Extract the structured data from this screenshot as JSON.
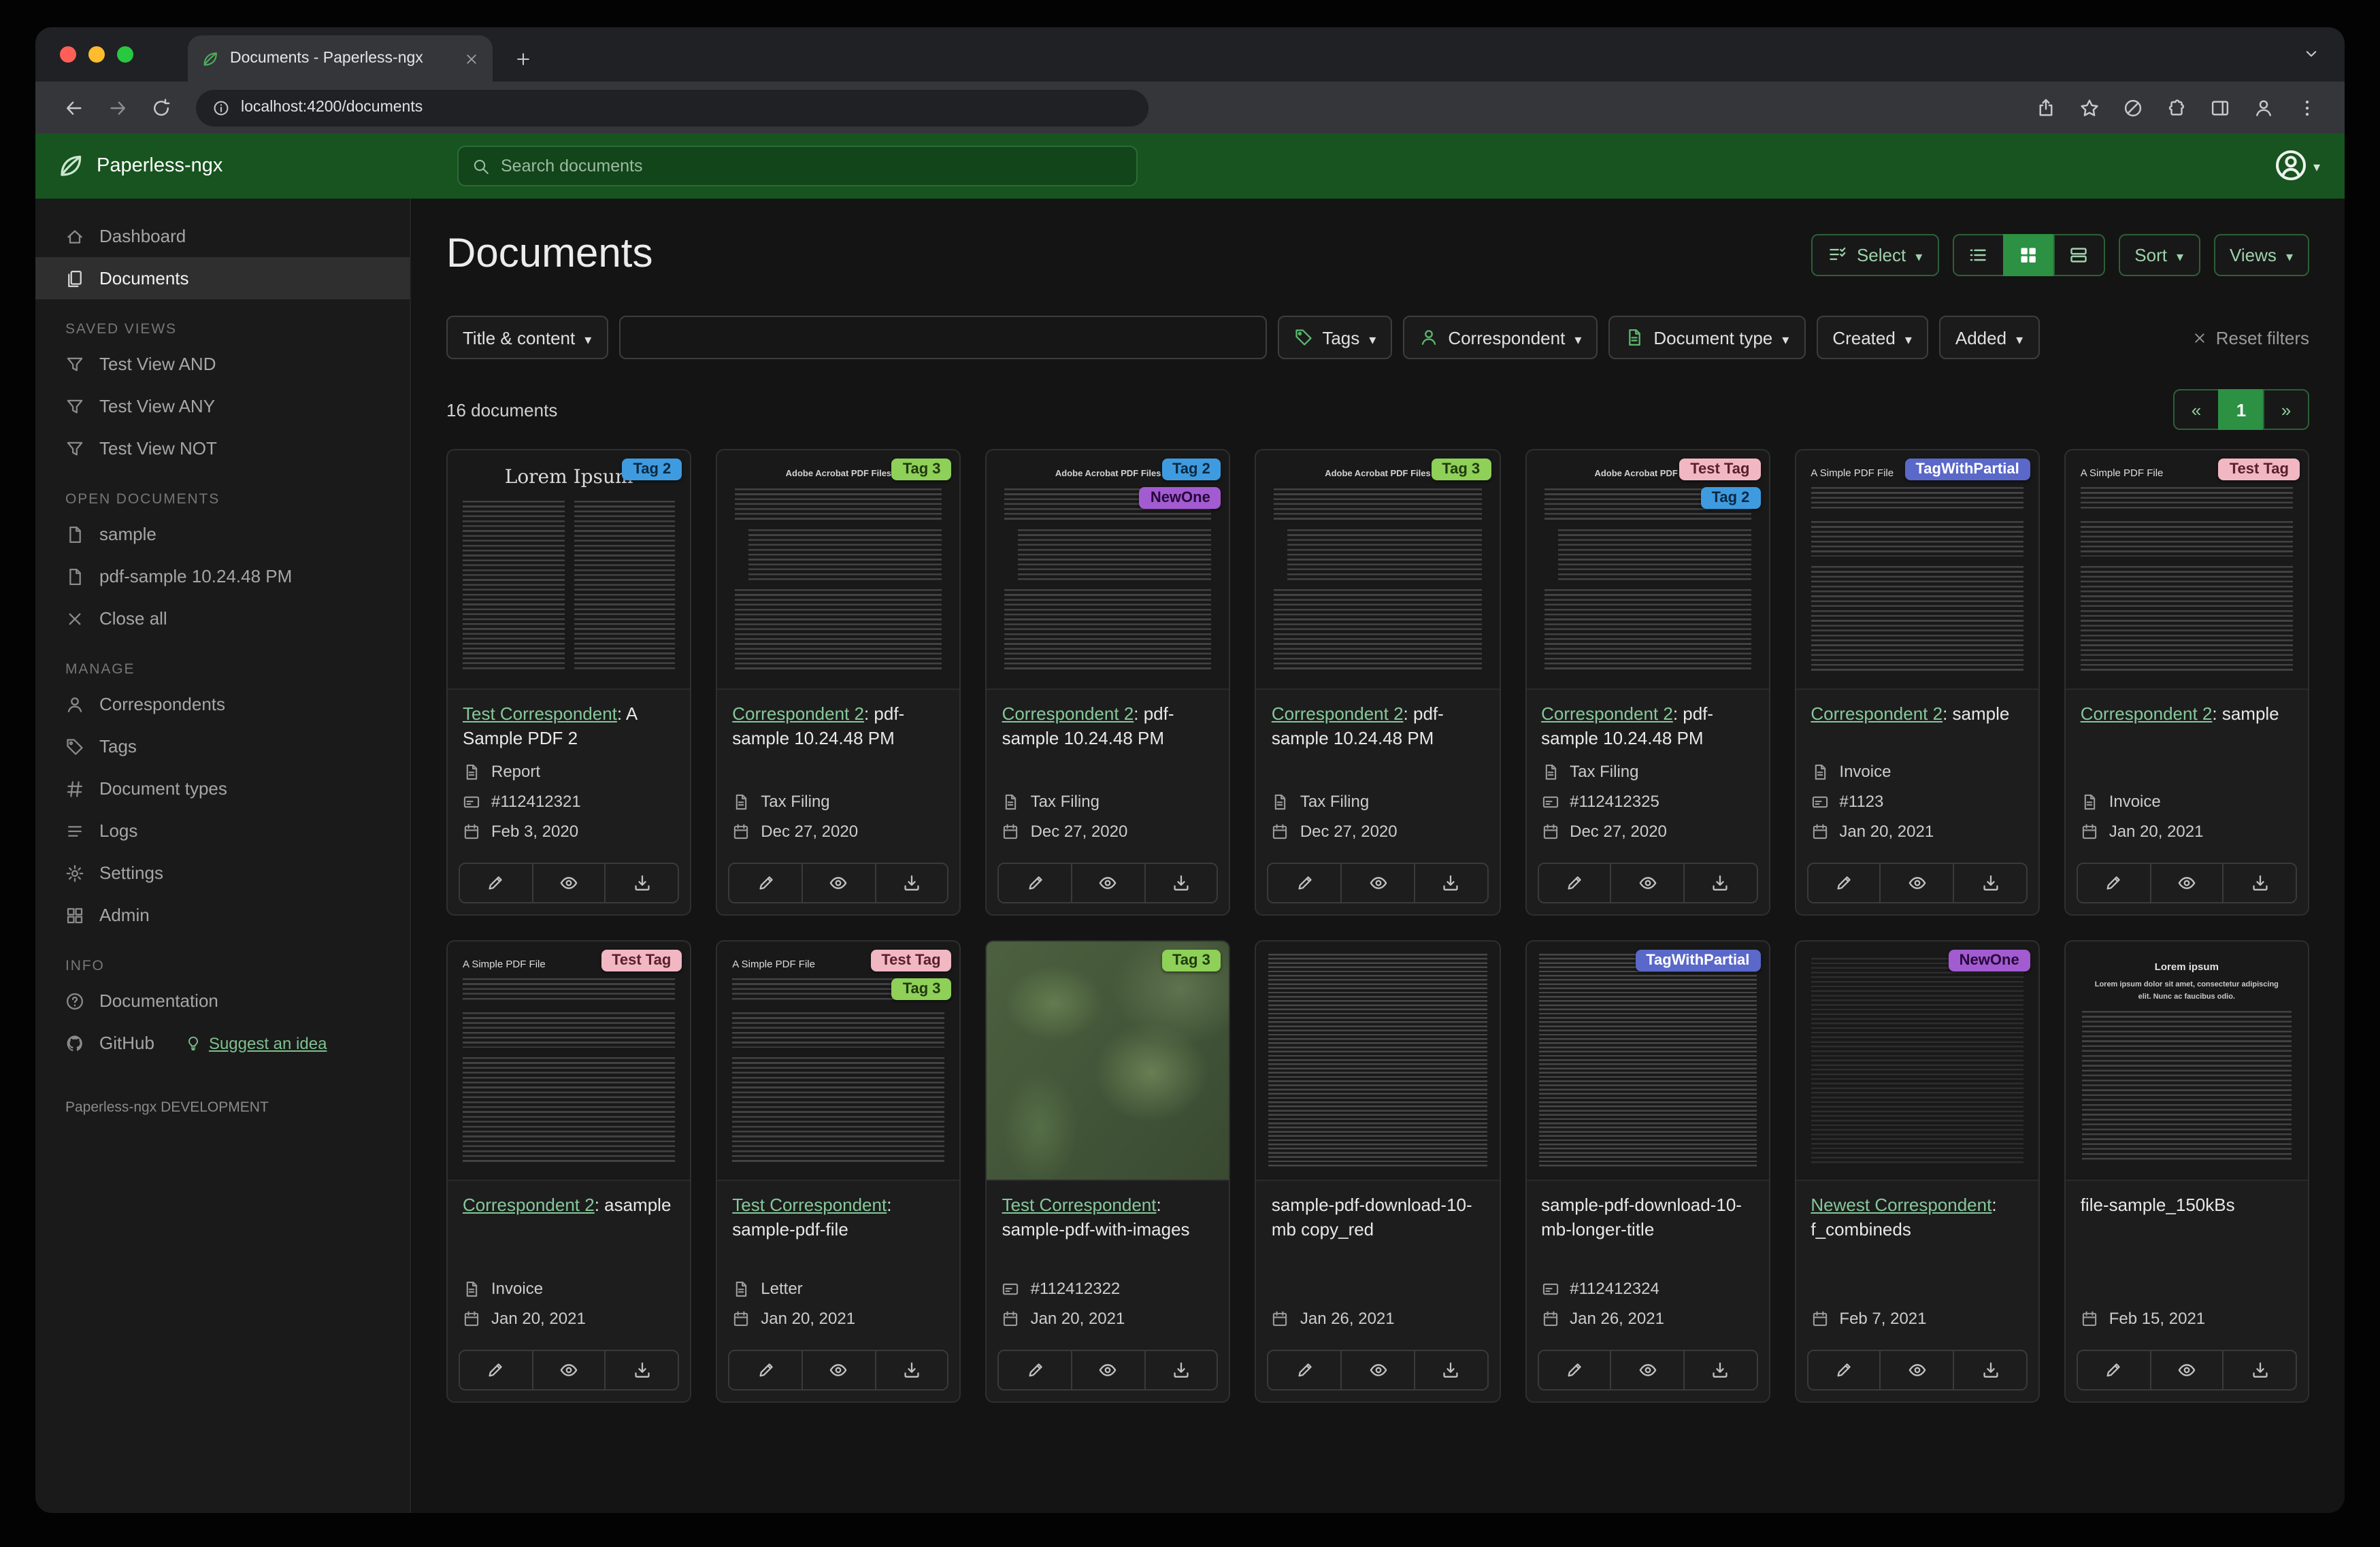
{
  "browser": {
    "tab_title": "Documents - Paperless-ngx",
    "url": "localhost:4200/documents"
  },
  "navbar": {
    "brand": "Paperless-ngx",
    "search_placeholder": "Search documents"
  },
  "sidebar": {
    "primary": [
      {
        "label": "Dashboard",
        "icon": "home"
      },
      {
        "label": "Documents",
        "icon": "files",
        "active": true
      }
    ],
    "sections": [
      {
        "heading": "SAVED VIEWS",
        "items": [
          {
            "label": "Test View AND",
            "icon": "funnel"
          },
          {
            "label": "Test View ANY",
            "icon": "funnel"
          },
          {
            "label": "Test View NOT",
            "icon": "funnel"
          }
        ]
      },
      {
        "heading": "OPEN DOCUMENTS",
        "items": [
          {
            "label": "sample",
            "icon": "doc"
          },
          {
            "label": "pdf-sample 10.24.48 PM",
            "icon": "doc"
          },
          {
            "label": "Close all",
            "icon": "xlg"
          }
        ]
      },
      {
        "heading": "MANAGE",
        "items": [
          {
            "label": "Correspondents",
            "icon": "person"
          },
          {
            "label": "Tags",
            "icon": "tag"
          },
          {
            "label": "Document types",
            "icon": "hash"
          },
          {
            "label": "Logs",
            "icon": "listul"
          },
          {
            "label": "Settings",
            "icon": "gear"
          },
          {
            "label": "Admin",
            "icon": "grid"
          }
        ]
      },
      {
        "heading": "INFO",
        "items": [
          {
            "label": "Documentation",
            "icon": "question"
          },
          {
            "label": "GitHub",
            "icon": "github",
            "link_label": "Suggest an idea"
          }
        ]
      }
    ],
    "footer": "Paperless-ngx DEVELOPMENT"
  },
  "header": {
    "title": "Documents",
    "select_label": "Select",
    "sort_label": "Sort",
    "views_label": "Views"
  },
  "filters": {
    "field_label": "Title & content",
    "input_value": "",
    "buttons": [
      "Tags",
      "Correspondent",
      "Document type",
      "Created",
      "Added"
    ],
    "reset_label": "Reset filters"
  },
  "results": {
    "count_text": "16 documents",
    "prev": "«",
    "page": "1",
    "next": "»"
  },
  "tag_colors": {
    "Tag 2": {
      "bg": "#3f9be0",
      "fg": "#0a2940"
    },
    "Tag 3": {
      "bg": "#8ed058",
      "fg": "#203a10"
    },
    "NewOne": {
      "bg": "#a35bd1",
      "fg": "#26093a"
    },
    "Test Tag": {
      "bg": "#f1b7c2",
      "fg": "#59202c"
    },
    "TagWithPartial": {
      "bg": "#5a68c9",
      "fg": "#ffffff"
    }
  },
  "documents": [
    {
      "tags": [
        "Tag 2"
      ],
      "correspondent": "Test Correspondent",
      "title_rest": ": A Sample PDF 2",
      "doc_type": "Report",
      "asn": "#112412321",
      "date": "Feb 3, 2020",
      "thumb": {
        "kind": "lorem",
        "title": "Lorem Ipsum"
      }
    },
    {
      "tags": [
        "Tag 3"
      ],
      "correspondent": "Correspondent 2",
      "title_rest": ": pdf-sample 10.24.48 PM",
      "doc_type": "Tax Filing",
      "date": "Dec 27, 2020",
      "thumb": {
        "kind": "acrobat",
        "title": "Adobe Acrobat PDF Files"
      }
    },
    {
      "tags": [
        "Tag 2",
        "NewOne"
      ],
      "correspondent": "Correspondent 2",
      "title_rest": ": pdf-sample 10.24.48 PM",
      "doc_type": "Tax Filing",
      "date": "Dec 27, 2020",
      "thumb": {
        "kind": "acrobat",
        "title": "Adobe Acrobat PDF Files"
      }
    },
    {
      "tags": [
        "Tag 3"
      ],
      "correspondent": "Correspondent 2",
      "title_rest": ": pdf-sample 10.24.48 PM",
      "doc_type": "Tax Filing",
      "date": "Dec 27, 2020",
      "thumb": {
        "kind": "acrobat",
        "title": "Adobe Acrobat PDF Files"
      }
    },
    {
      "tags": [
        "Test Tag",
        "Tag 2"
      ],
      "correspondent": "Correspondent 2",
      "title_rest": ": pdf-sample 10.24.48 PM",
      "doc_type": "Tax Filing",
      "asn": "#112412325",
      "date": "Dec 27, 2020",
      "thumb": {
        "kind": "acrobat",
        "title": "Adobe Acrobat PDF Files"
      }
    },
    {
      "tags": [
        "TagWithPartial"
      ],
      "correspondent": "Correspondent 2",
      "title_rest": ": sample",
      "doc_type": "Invoice",
      "asn": "#1123",
      "date": "Jan 20, 2021",
      "thumb": {
        "kind": "simple",
        "title": "A Simple PDF File"
      }
    },
    {
      "tags": [
        "Test Tag"
      ],
      "correspondent": "Correspondent 2",
      "title_rest": ": sample",
      "doc_type": "Invoice",
      "date": "Jan 20, 2021",
      "thumb": {
        "kind": "simple",
        "title": "A Simple PDF File"
      }
    },
    {
      "tags": [
        "Test Tag"
      ],
      "correspondent": "Correspondent 2",
      "title_rest": ": asample",
      "doc_type": "Invoice",
      "date": "Jan 20, 2021",
      "thumb": {
        "kind": "simple",
        "title": "A Simple PDF File"
      }
    },
    {
      "tags": [
        "Test Tag",
        "Tag 3"
      ],
      "correspondent": "Test Correspondent",
      "title_rest": ": sample-pdf-file",
      "doc_type": "Letter",
      "date": "Jan 20, 2021",
      "thumb": {
        "kind": "simple",
        "title": "A Simple PDF File"
      }
    },
    {
      "tags": [
        "Tag 3"
      ],
      "correspondent": "Test Correspondent",
      "title_rest": ": sample-pdf-with-images",
      "asn": "#112412322",
      "date": "Jan 20, 2021",
      "thumb": {
        "kind": "map",
        "title": ""
      }
    },
    {
      "tags": [],
      "correspondent": "",
      "title_rest": "sample-pdf-download-10-mb copy_red",
      "date": "Jan 26, 2021",
      "thumb": {
        "kind": "dense",
        "title": ""
      }
    },
    {
      "tags": [
        "TagWithPartial"
      ],
      "correspondent": "",
      "title_rest": "sample-pdf-download-10-mb-longer-title",
      "asn": "#112412324",
      "date": "Jan 26, 2021",
      "thumb": {
        "kind": "dense",
        "title": ""
      }
    },
    {
      "tags": [
        "NewOne"
      ],
      "correspondent": "Newest Correspondent",
      "title_rest": ": f_combineds",
      "date": "Feb 7, 2021",
      "thumb": {
        "kind": "dark",
        "title": ""
      }
    },
    {
      "tags": [],
      "correspondent": "",
      "title_rest": "file-sample_150kBs",
      "date": "Feb 15, 2021",
      "thumb": {
        "kind": "loremc",
        "title": "Lorem ipsum",
        "sub": "Lorem ipsum dolor sit amet, consectetur adipiscing elit. Nunc ac faucibus odio."
      }
    }
  ]
}
